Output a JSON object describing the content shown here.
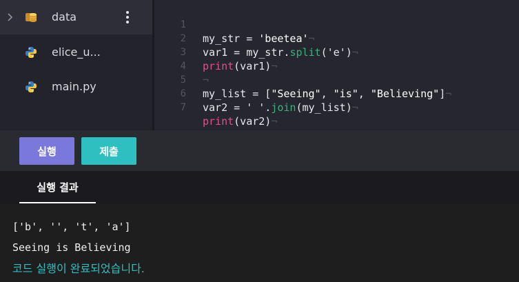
{
  "sidebar": {
    "items": [
      {
        "name": "data",
        "icon": "database-icon",
        "type": "folder"
      },
      {
        "name": "elice_u...",
        "icon": "python-icon",
        "type": "file"
      },
      {
        "name": "main.py",
        "icon": "python-icon",
        "type": "file"
      }
    ]
  },
  "editor": {
    "lines": [
      {
        "num": "1",
        "code": "my_str = 'beetea'"
      },
      {
        "num": "2",
        "code": "var1 = my_str.split('e')"
      },
      {
        "num": "3",
        "code": "print(var1)"
      },
      {
        "num": "4",
        "code": ""
      },
      {
        "num": "5",
        "code": "my_list = [\"Seeing\", \"is\", \"Believing\"]"
      },
      {
        "num": "6",
        "code": "var2 = ' '.join(my_list)"
      },
      {
        "num": "7",
        "code": "print(var2)"
      }
    ],
    "eol_marker": "¬"
  },
  "toolbar": {
    "run_label": "실행",
    "submit_label": "제출"
  },
  "result_tab": {
    "label": "실행 결과"
  },
  "output": {
    "lines": [
      "['b', '', 't', 'a']",
      "Seeing is Believing"
    ],
    "status": "코드 실행이 완료되었습니다."
  },
  "colors": {
    "run_button": "#7b78dc",
    "submit_button": "#2fbfc0",
    "status_text": "#2fbfc0",
    "function_token": "#36b37e",
    "keyword_token": "#e0508a"
  }
}
